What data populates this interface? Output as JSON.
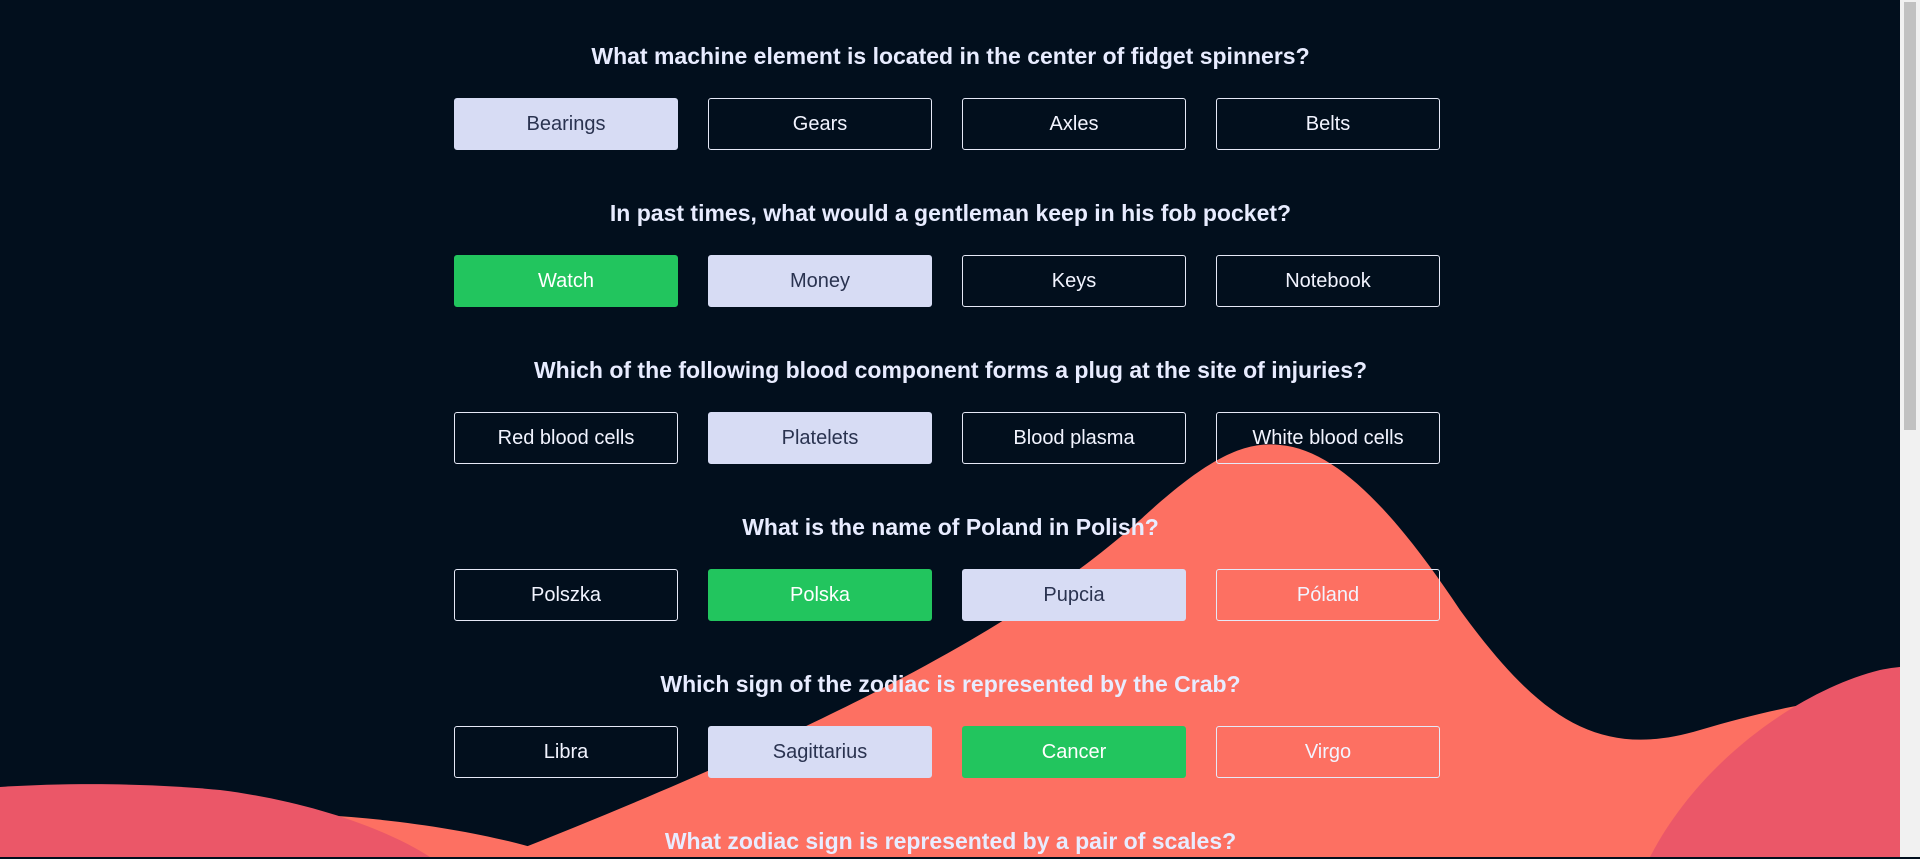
{
  "questions": [
    {
      "question": "What machine element is located in the center of fidget spinners?",
      "answers": [
        {
          "label": "Bearings",
          "state": "selected"
        },
        {
          "label": "Gears",
          "state": "default"
        },
        {
          "label": "Axles",
          "state": "default"
        },
        {
          "label": "Belts",
          "state": "default"
        }
      ]
    },
    {
      "question": "In past times, what would a gentleman keep in his fob pocket?",
      "answers": [
        {
          "label": "Watch",
          "state": "correct"
        },
        {
          "label": "Money",
          "state": "selected"
        },
        {
          "label": "Keys",
          "state": "default"
        },
        {
          "label": "Notebook",
          "state": "default"
        }
      ]
    },
    {
      "question": "Which of the following blood component forms a plug at the site of injuries?",
      "answers": [
        {
          "label": "Red blood cells",
          "state": "default"
        },
        {
          "label": "Platelets",
          "state": "selected"
        },
        {
          "label": "Blood plasma",
          "state": "default"
        },
        {
          "label": "White blood cells",
          "state": "default"
        }
      ]
    },
    {
      "question": "What is the name of Poland in Polish?",
      "answers": [
        {
          "label": "Polszka",
          "state": "default"
        },
        {
          "label": "Polska",
          "state": "correct"
        },
        {
          "label": "Pupcia",
          "state": "selected"
        },
        {
          "label": "Póland",
          "state": "default"
        }
      ]
    },
    {
      "question": "Which sign of the zodiac is represented by the Crab?",
      "answers": [
        {
          "label": "Libra",
          "state": "default"
        },
        {
          "label": "Sagittarius",
          "state": "selected"
        },
        {
          "label": "Cancer",
          "state": "correct"
        },
        {
          "label": "Virgo",
          "state": "default"
        }
      ]
    },
    {
      "question": "What zodiac sign is represented by a pair of scales?",
      "answers": []
    }
  ],
  "colors": {
    "background": "#020f1d",
    "selected": "#d7dcf4",
    "correct": "#22c55e",
    "wave_light": "#fd7062",
    "wave_dark": "#eb5768"
  }
}
